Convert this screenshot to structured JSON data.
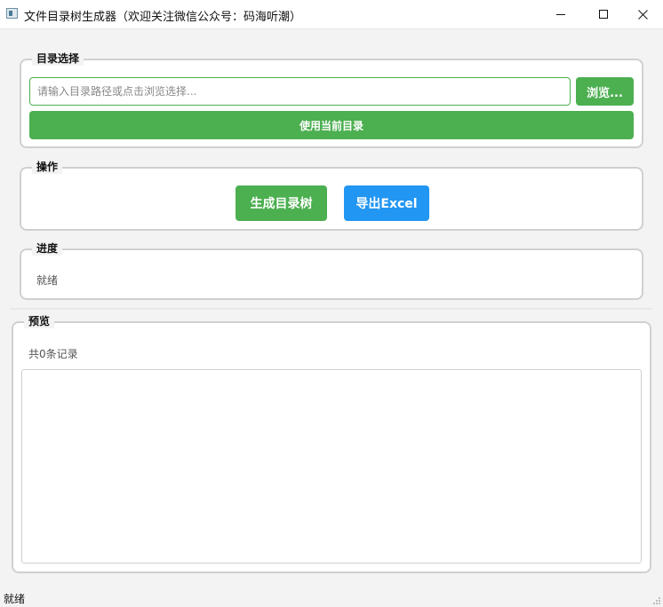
{
  "window": {
    "title": "文件目录树生成器（欢迎关注微信公众号：码海听潮）",
    "icons": {
      "app": "app-icon",
      "minimize": "minimize-icon",
      "maximize": "maximize-icon",
      "close": "close-icon"
    }
  },
  "directory_group": {
    "title": "目录选择",
    "input_placeholder": "请输入目录路径或点击浏览选择...",
    "input_value": "",
    "browse_label": "浏览...",
    "use_current_label": "使用当前目录"
  },
  "operation_group": {
    "title": "操作",
    "generate_label": "生成目录树",
    "export_label": "导出Excel"
  },
  "progress_group": {
    "title": "进度",
    "status": "就绪"
  },
  "preview_group": {
    "title": "预览",
    "count_text": "共0条记录"
  },
  "statusbar": {
    "text": "就绪",
    "grip_icon": "resize-grip-icon"
  },
  "colors": {
    "primary_green": "#4caf50",
    "primary_blue": "#2196f3",
    "group_border": "#d0d0d0"
  }
}
